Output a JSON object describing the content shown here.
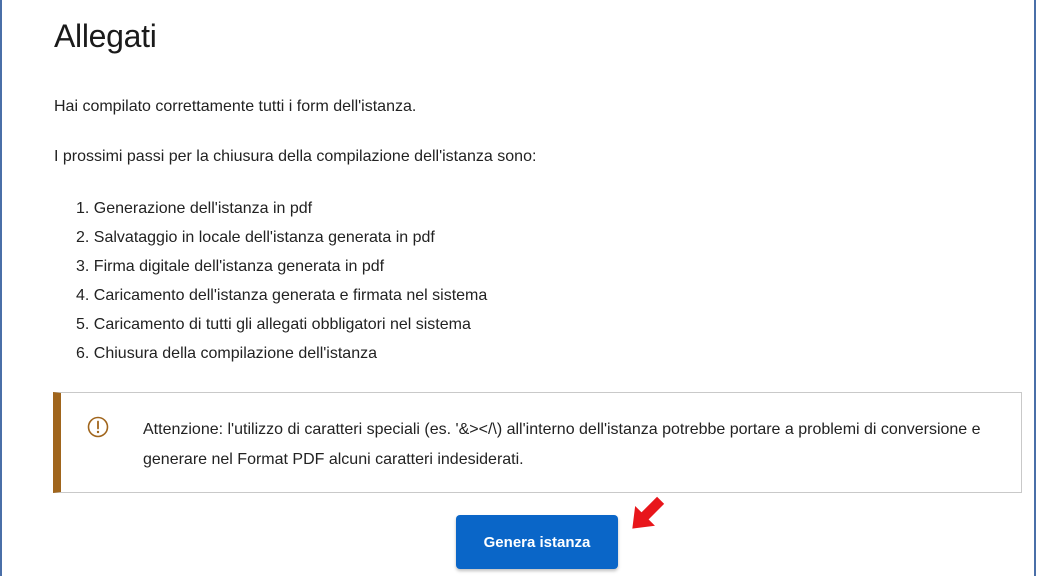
{
  "section": {
    "title": "Allegati"
  },
  "intro": {
    "line1": "Hai compilato correttamente tutti i form dell'istanza.",
    "line2": "I prossimi passi per la chiusura della compilazione dell'istanza sono:"
  },
  "steps": [
    "1. Generazione dell'istanza in pdf",
    "2. Salvataggio in locale dell'istanza generata in pdf",
    "3. Firma digitale dell'istanza generata in pdf",
    "4. Caricamento dell'istanza generata e firmata nel sistema",
    "5. Caricamento di tutti gli allegati obbligatori nel sistema",
    "6. Chiusura della compilazione dell'istanza"
  ],
  "alert": {
    "icon": "warning-circle-icon",
    "text": "Attenzione: l'utilizzo di caratteri speciali (es. '&></\\) all'interno dell'istanza potrebbe portare a problemi di conversione e generare nel Format PDF alcuni caratteri indesiderati.",
    "accent_color": "#a0651c"
  },
  "actions": {
    "generate_label": "Genera istanza",
    "button_color": "#0a66c8"
  },
  "annotation": {
    "icon": "red-arrow-icon",
    "color": "#e8161b"
  }
}
